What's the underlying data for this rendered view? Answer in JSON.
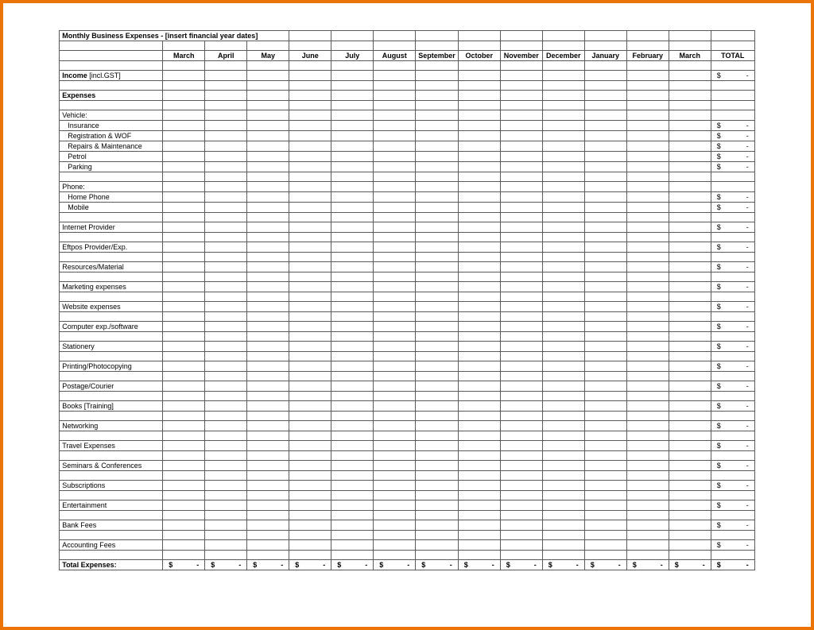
{
  "title": "Monthly Business Expenses - [insert financial year dates]",
  "months": [
    "March",
    "April",
    "May",
    "June",
    "July",
    "August",
    "September",
    "October",
    "November",
    "December",
    "January",
    "February",
    "March"
  ],
  "total_header": "TOTAL",
  "income_label": "Income",
  "income_suffix": " [incl.GST]",
  "expenses_header": "Expenses",
  "total_expenses": "Total Expenses:",
  "currency": "$",
  "dash": "-",
  "rows": [
    {
      "type": "blank"
    },
    {
      "type": "section",
      "text": "Vehicle:"
    },
    {
      "type": "item",
      "text": "Insurance",
      "total": true
    },
    {
      "type": "item",
      "text": "Registration & WOF",
      "total": true
    },
    {
      "type": "item",
      "text": "Repairs & Maintenance",
      "total": true
    },
    {
      "type": "item",
      "text": "Petrol",
      "total": true
    },
    {
      "type": "item",
      "text": "Parking",
      "total": true
    },
    {
      "type": "blank"
    },
    {
      "type": "section",
      "text": "Phone:"
    },
    {
      "type": "item",
      "text": "Home Phone",
      "total": true
    },
    {
      "type": "item",
      "text": "Mobile",
      "total": true
    },
    {
      "type": "blank"
    },
    {
      "type": "line",
      "text": "Internet Provider",
      "total": true
    },
    {
      "type": "blank"
    },
    {
      "type": "line",
      "text": "Eftpos Provider/Exp.",
      "total": true
    },
    {
      "type": "blank"
    },
    {
      "type": "line",
      "text": "Resources/Material",
      "total": true
    },
    {
      "type": "blank"
    },
    {
      "type": "line",
      "text": "Marketing expenses",
      "total": true
    },
    {
      "type": "blank"
    },
    {
      "type": "line",
      "text": "Website expenses",
      "total": true
    },
    {
      "type": "blank"
    },
    {
      "type": "line",
      "text": "Computer exp./software",
      "total": true
    },
    {
      "type": "blank"
    },
    {
      "type": "line",
      "text": "Stationery",
      "total": true
    },
    {
      "type": "blank"
    },
    {
      "type": "line",
      "text": "Printing/Photocopying",
      "total": true
    },
    {
      "type": "blank"
    },
    {
      "type": "line",
      "text": "Postage/Courier",
      "total": true
    },
    {
      "type": "blank"
    },
    {
      "type": "line",
      "text": "Books [Training]",
      "total": true
    },
    {
      "type": "blank"
    },
    {
      "type": "line",
      "text": "Networking",
      "total": true
    },
    {
      "type": "blank"
    },
    {
      "type": "line",
      "text": "Travel Expenses",
      "total": true
    },
    {
      "type": "blank"
    },
    {
      "type": "line",
      "text": "Seminars & Conferences",
      "total": true
    },
    {
      "type": "blank"
    },
    {
      "type": "line",
      "text": "Subscriptions",
      "total": true
    },
    {
      "type": "blank"
    },
    {
      "type": "line",
      "text": "Entertainment",
      "total": true
    },
    {
      "type": "blank"
    },
    {
      "type": "line",
      "text": "Bank Fees",
      "total": true
    },
    {
      "type": "blank"
    },
    {
      "type": "line",
      "text": "Accounting Fees",
      "total": true
    },
    {
      "type": "blank"
    }
  ]
}
